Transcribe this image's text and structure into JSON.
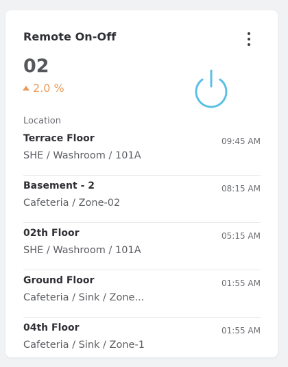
{
  "card": {
    "title": "Remote On-Off",
    "count": "02",
    "trend": "2.0 %",
    "trend_color": "#ec9a58",
    "power_icon": "power-icon",
    "power_color": "#5bbfe6",
    "location_label": "Location",
    "menu_icon": "kebab-menu-icon"
  },
  "locations": [
    {
      "name": "Terrace Floor",
      "path": "SHE / Washroom / 101A",
      "time": "09:45 AM"
    },
    {
      "name": "Basement - 2",
      "path": "Cafeteria / Zone-02",
      "time": "08:15 AM"
    },
    {
      "name": "02th Floor",
      "path": "SHE / Washroom / 101A",
      "time": "05:15 AM"
    },
    {
      "name": "Ground Floor",
      "path": "Cafeteria / Sink / Zone...",
      "time": "01:55 AM"
    },
    {
      "name": "04th Floor",
      "path": "Cafeteria / Sink / Zone-1",
      "time": "01:55 AM"
    }
  ]
}
